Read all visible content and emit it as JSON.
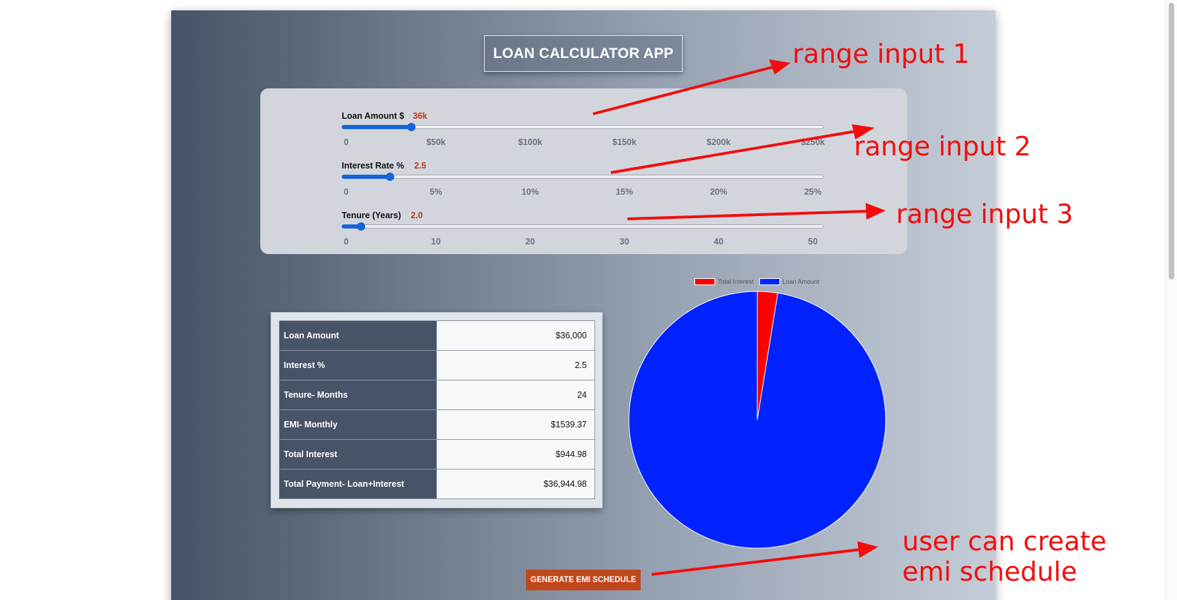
{
  "app": {
    "title": "LOAN CALCULATOR APP"
  },
  "controls": [
    {
      "label": "Loan Amount $",
      "value": "36k",
      "fraction": 0.144,
      "ticks": [
        "0",
        "$50k",
        "$100k",
        "$150k",
        "$200k",
        "$250k"
      ]
    },
    {
      "label": "Interest Rate %",
      "value": "2.5",
      "fraction": 0.1,
      "ticks": [
        "0",
        "5%",
        "10%",
        "15%",
        "20%",
        "25%"
      ]
    },
    {
      "label": "Tenure (Years)",
      "value": "2.0",
      "fraction": 0.04,
      "ticks": [
        "0",
        "10",
        "20",
        "30",
        "40",
        "50"
      ]
    }
  ],
  "summary": {
    "rows": [
      {
        "label": "Loan Amount",
        "value": "$36,000"
      },
      {
        "label": "Interest %",
        "value": "2.5"
      },
      {
        "label": "Tenure- Months",
        "value": "24"
      },
      {
        "label": "EMI- Monthly",
        "value": "$1539.37"
      },
      {
        "label": "Total Interest",
        "value": "$944.98"
      },
      {
        "label": "Total Payment- Loan+Interest",
        "value": "$36,944.98"
      }
    ]
  },
  "chart_data": {
    "type": "pie",
    "labels": [
      "Total Interest",
      "Loan Amount"
    ],
    "values": [
      944.98,
      36000
    ],
    "colors": [
      "#ff0000",
      "#0022ff"
    ],
    "legend_position": "top"
  },
  "buttons": {
    "generate": "GENERATE EMI SCHEDULE"
  },
  "annotations": {
    "range1": "range input 1",
    "range2": "range input 2",
    "range3": "range input 3",
    "emi": [
      "user can create",
      "emi schedule"
    ]
  }
}
